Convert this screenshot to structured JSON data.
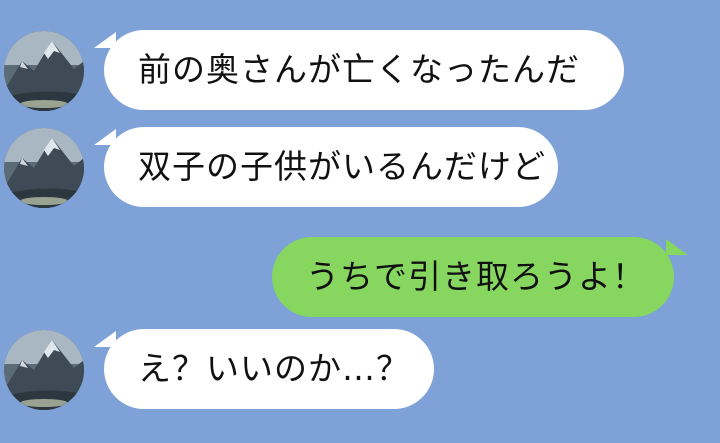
{
  "chat": {
    "background_color": "#7ea2d8",
    "incoming_bubble_color": "#ffffff",
    "outgoing_bubble_color": "#86d660",
    "messages": [
      {
        "direction": "incoming",
        "text": "前の奥さんが亡くなったんだ",
        "avatar_icon": "mountain-avatar-icon"
      },
      {
        "direction": "incoming",
        "text": "双子の子供がいるんだけど",
        "avatar_icon": "mountain-avatar-icon"
      },
      {
        "direction": "outgoing",
        "text": "うちで引き取ろうよ！"
      },
      {
        "direction": "incoming",
        "text": "え？いいのか…？",
        "avatar_icon": "mountain-avatar-icon"
      }
    ]
  }
}
